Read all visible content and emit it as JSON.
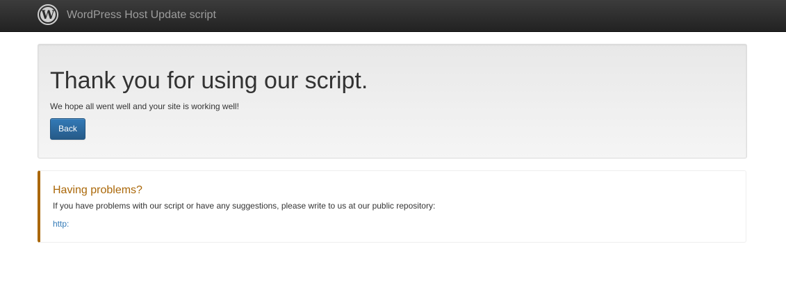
{
  "navbar": {
    "brand_title": "WordPress Host Update script",
    "logo_icon": "wordpress-logo-icon"
  },
  "jumbotron": {
    "heading": "Thank you for using our script.",
    "text": "We hope all went well and your site is working well!",
    "back_label": "Back"
  },
  "callout": {
    "title": "Having problems?",
    "text": "If you have problems with our script or have any suggestions, please write to us at our public repository:",
    "link_text": "http:"
  },
  "colors": {
    "navbar_bg": "#222222",
    "brand_text": "#9d9d9d",
    "primary_button": "#337ab7",
    "callout_accent": "#aa6708",
    "link": "#337ab7"
  }
}
